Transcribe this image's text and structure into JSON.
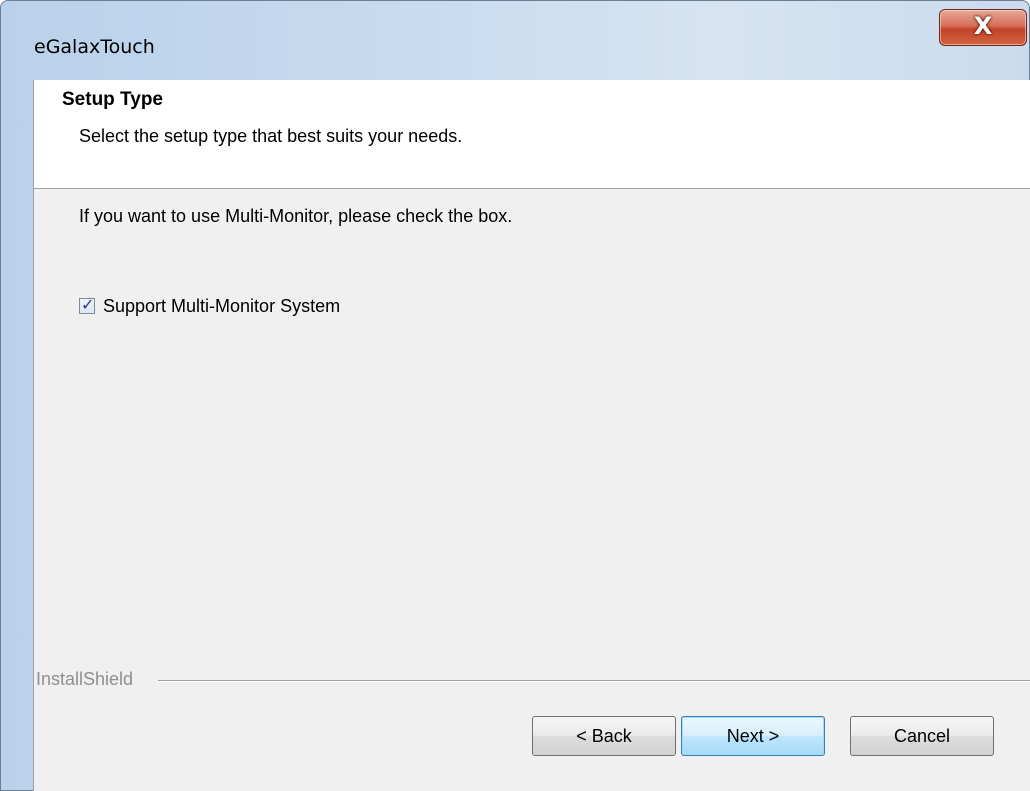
{
  "window": {
    "title": "eGalaxTouch",
    "close_glyph": "X"
  },
  "header": {
    "title": "Setup Type",
    "subtitle": "Select the setup type that best suits your needs."
  },
  "body": {
    "instruction": "If you want to use Multi-Monitor, please check the box.",
    "checkbox": {
      "label": "Support Multi-Monitor System",
      "checked": true
    }
  },
  "footer": {
    "brand": "InstallShield",
    "back_label": "< Back",
    "next_label": "Next >",
    "cancel_label": "Cancel"
  },
  "colors": {
    "accent": "#3c7fb1",
    "close_button": "#c2432a",
    "client_bg": "#f0f0f0"
  },
  "icons": {
    "close": "close-icon",
    "check": "checkmark-icon"
  }
}
